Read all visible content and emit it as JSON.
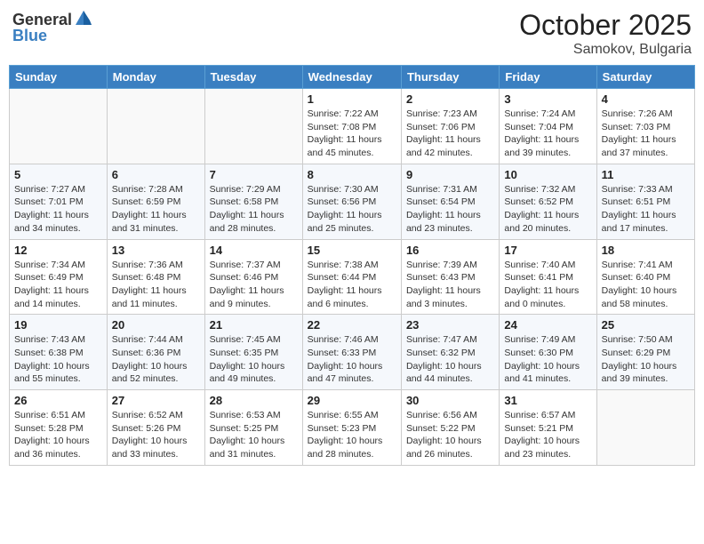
{
  "header": {
    "logo_general": "General",
    "logo_blue": "Blue",
    "month": "October 2025",
    "location": "Samokov, Bulgaria"
  },
  "weekdays": [
    "Sunday",
    "Monday",
    "Tuesday",
    "Wednesday",
    "Thursday",
    "Friday",
    "Saturday"
  ],
  "weeks": [
    [
      {
        "day": "",
        "info": ""
      },
      {
        "day": "",
        "info": ""
      },
      {
        "day": "",
        "info": ""
      },
      {
        "day": "1",
        "info": "Sunrise: 7:22 AM\nSunset: 7:08 PM\nDaylight: 11 hours and 45 minutes."
      },
      {
        "day": "2",
        "info": "Sunrise: 7:23 AM\nSunset: 7:06 PM\nDaylight: 11 hours and 42 minutes."
      },
      {
        "day": "3",
        "info": "Sunrise: 7:24 AM\nSunset: 7:04 PM\nDaylight: 11 hours and 39 minutes."
      },
      {
        "day": "4",
        "info": "Sunrise: 7:26 AM\nSunset: 7:03 PM\nDaylight: 11 hours and 37 minutes."
      }
    ],
    [
      {
        "day": "5",
        "info": "Sunrise: 7:27 AM\nSunset: 7:01 PM\nDaylight: 11 hours and 34 minutes."
      },
      {
        "day": "6",
        "info": "Sunrise: 7:28 AM\nSunset: 6:59 PM\nDaylight: 11 hours and 31 minutes."
      },
      {
        "day": "7",
        "info": "Sunrise: 7:29 AM\nSunset: 6:58 PM\nDaylight: 11 hours and 28 minutes."
      },
      {
        "day": "8",
        "info": "Sunrise: 7:30 AM\nSunset: 6:56 PM\nDaylight: 11 hours and 25 minutes."
      },
      {
        "day": "9",
        "info": "Sunrise: 7:31 AM\nSunset: 6:54 PM\nDaylight: 11 hours and 23 minutes."
      },
      {
        "day": "10",
        "info": "Sunrise: 7:32 AM\nSunset: 6:52 PM\nDaylight: 11 hours and 20 minutes."
      },
      {
        "day": "11",
        "info": "Sunrise: 7:33 AM\nSunset: 6:51 PM\nDaylight: 11 hours and 17 minutes."
      }
    ],
    [
      {
        "day": "12",
        "info": "Sunrise: 7:34 AM\nSunset: 6:49 PM\nDaylight: 11 hours and 14 minutes."
      },
      {
        "day": "13",
        "info": "Sunrise: 7:36 AM\nSunset: 6:48 PM\nDaylight: 11 hours and 11 minutes."
      },
      {
        "day": "14",
        "info": "Sunrise: 7:37 AM\nSunset: 6:46 PM\nDaylight: 11 hours and 9 minutes."
      },
      {
        "day": "15",
        "info": "Sunrise: 7:38 AM\nSunset: 6:44 PM\nDaylight: 11 hours and 6 minutes."
      },
      {
        "day": "16",
        "info": "Sunrise: 7:39 AM\nSunset: 6:43 PM\nDaylight: 11 hours and 3 minutes."
      },
      {
        "day": "17",
        "info": "Sunrise: 7:40 AM\nSunset: 6:41 PM\nDaylight: 11 hours and 0 minutes."
      },
      {
        "day": "18",
        "info": "Sunrise: 7:41 AM\nSunset: 6:40 PM\nDaylight: 10 hours and 58 minutes."
      }
    ],
    [
      {
        "day": "19",
        "info": "Sunrise: 7:43 AM\nSunset: 6:38 PM\nDaylight: 10 hours and 55 minutes."
      },
      {
        "day": "20",
        "info": "Sunrise: 7:44 AM\nSunset: 6:36 PM\nDaylight: 10 hours and 52 minutes."
      },
      {
        "day": "21",
        "info": "Sunrise: 7:45 AM\nSunset: 6:35 PM\nDaylight: 10 hours and 49 minutes."
      },
      {
        "day": "22",
        "info": "Sunrise: 7:46 AM\nSunset: 6:33 PM\nDaylight: 10 hours and 47 minutes."
      },
      {
        "day": "23",
        "info": "Sunrise: 7:47 AM\nSunset: 6:32 PM\nDaylight: 10 hours and 44 minutes."
      },
      {
        "day": "24",
        "info": "Sunrise: 7:49 AM\nSunset: 6:30 PM\nDaylight: 10 hours and 41 minutes."
      },
      {
        "day": "25",
        "info": "Sunrise: 7:50 AM\nSunset: 6:29 PM\nDaylight: 10 hours and 39 minutes."
      }
    ],
    [
      {
        "day": "26",
        "info": "Sunrise: 6:51 AM\nSunset: 5:28 PM\nDaylight: 10 hours and 36 minutes."
      },
      {
        "day": "27",
        "info": "Sunrise: 6:52 AM\nSunset: 5:26 PM\nDaylight: 10 hours and 33 minutes."
      },
      {
        "day": "28",
        "info": "Sunrise: 6:53 AM\nSunset: 5:25 PM\nDaylight: 10 hours and 31 minutes."
      },
      {
        "day": "29",
        "info": "Sunrise: 6:55 AM\nSunset: 5:23 PM\nDaylight: 10 hours and 28 minutes."
      },
      {
        "day": "30",
        "info": "Sunrise: 6:56 AM\nSunset: 5:22 PM\nDaylight: 10 hours and 26 minutes."
      },
      {
        "day": "31",
        "info": "Sunrise: 6:57 AM\nSunset: 5:21 PM\nDaylight: 10 hours and 23 minutes."
      },
      {
        "day": "",
        "info": ""
      }
    ]
  ]
}
